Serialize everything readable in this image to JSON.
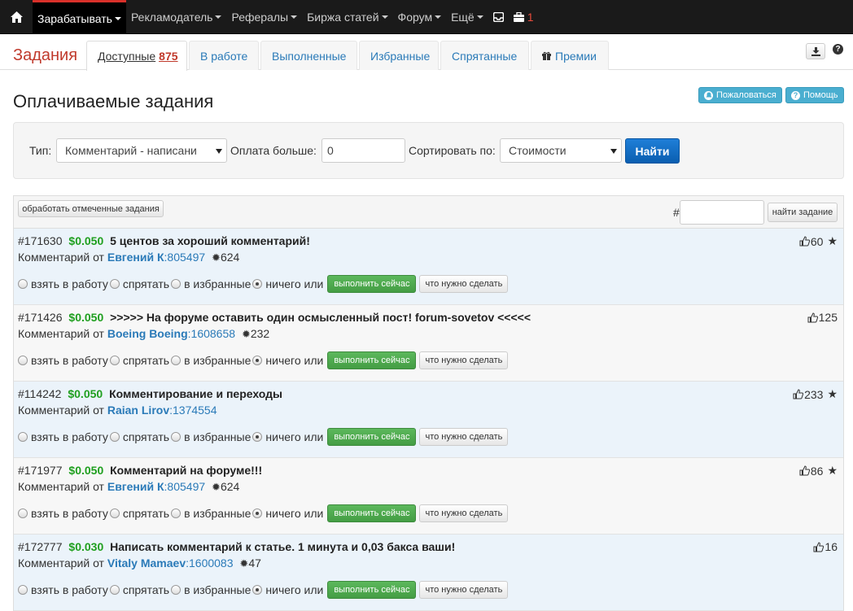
{
  "nav": {
    "items": [
      {
        "label": "Зарабатывать",
        "active": true
      },
      {
        "label": "Рекламодатель"
      },
      {
        "label": "Рефералы"
      },
      {
        "label": "Биржа статей"
      },
      {
        "label": "Форум"
      },
      {
        "label": "Ещё"
      }
    ],
    "briefcase_count": "1"
  },
  "section_title": "Задания",
  "tabs": [
    {
      "label": "Доступные",
      "count": "875",
      "active": true
    },
    {
      "label": "В работе"
    },
    {
      "label": "Выполненные"
    },
    {
      "label": "Избранные"
    },
    {
      "label": "Спрятанные"
    },
    {
      "label": "Премии",
      "icon": "gift-icon"
    }
  ],
  "page_title": "Оплачиваемые задания",
  "header_buttons": {
    "complain": "Пожаловаться",
    "help": "Помощь"
  },
  "filter": {
    "type_label": "Тип:",
    "type_value": "Комментарий - написани",
    "pay_label": "Оплата больше:",
    "pay_value": "0",
    "sort_label": "Сортировать по:",
    "sort_value": "Стоимости",
    "find_label": "Найти"
  },
  "list_head": {
    "process_label": "обработать отмеченные задания",
    "hash": "#",
    "find_task_label": "найти задание"
  },
  "row_labels": {
    "comment_from": "Комментарий от",
    "take": "взять в работу",
    "hide": "спрятать",
    "favorite": "в избранные",
    "nothing": "ничего или",
    "do_now": "выполнить сейчас",
    "what_to_do": "что нужно сделать"
  },
  "tasks": [
    {
      "id": "#171630",
      "price": "$0.050",
      "title": "5 центов за хороший комментарий!",
      "author": "Евгений К",
      "uid": ":805497",
      "rating": "624",
      "likes": "60",
      "starred": true
    },
    {
      "id": "#171426",
      "price": "$0.050",
      "title": ">>>>> На форуме оставить один осмысленный пост! forum-sovetov <<<<<",
      "author": "Boeing Boeing",
      "uid": ":1608658",
      "rating": "232",
      "likes": "125",
      "starred": false
    },
    {
      "id": "#114242",
      "price": "$0.050",
      "title": "Комментирование и переходы",
      "author": "Raian Lirov",
      "uid": ":1374554",
      "rating": "",
      "likes": "233",
      "starred": true
    },
    {
      "id": "#171977",
      "price": "$0.050",
      "title": "Комментарий на форуме!!!",
      "author": "Евгений К",
      "uid": ":805497",
      "rating": "624",
      "likes": "86",
      "starred": true
    },
    {
      "id": "#172777",
      "price": "$0.030",
      "title": "Написать комментарий к статье. 1 минута и 0,03 бакса ваши!",
      "author": "Vitaly Mamaev",
      "uid": ":1600083",
      "rating": "47",
      "likes": "16",
      "starred": false
    }
  ]
}
